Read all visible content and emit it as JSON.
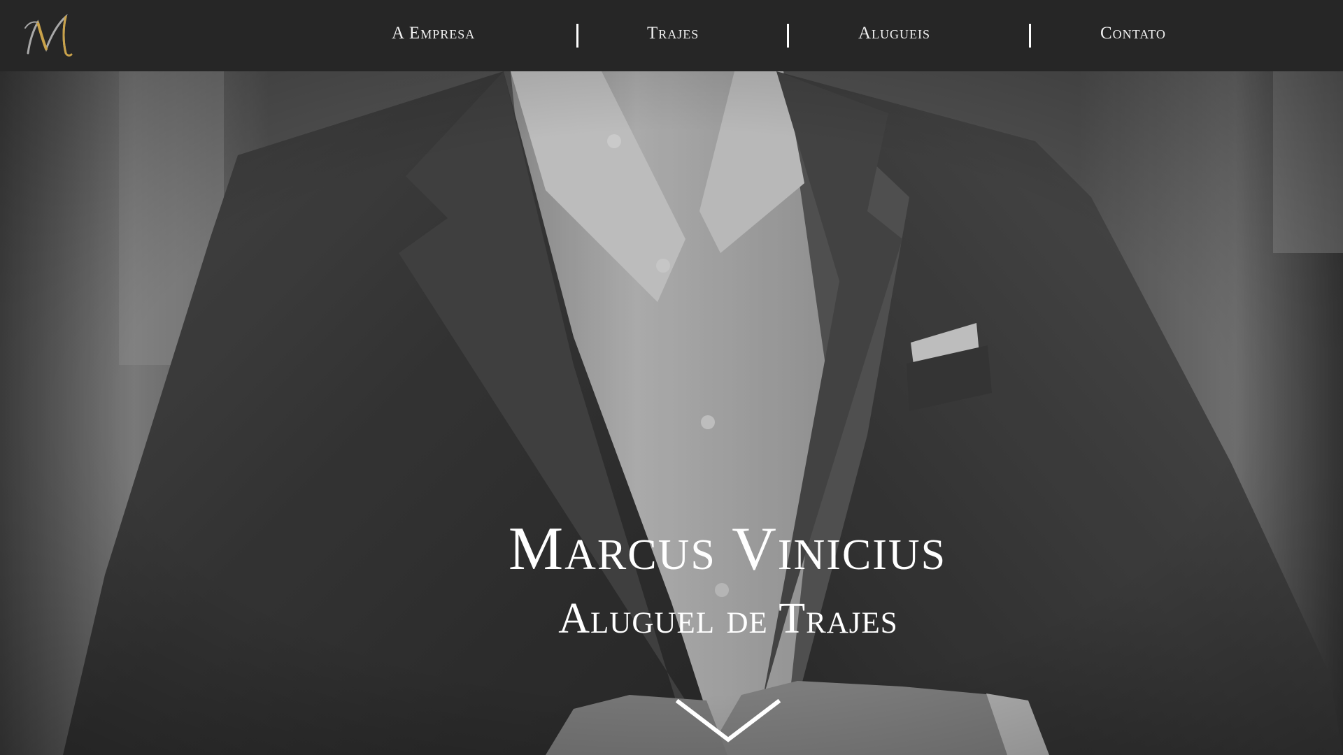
{
  "navbar": {
    "logo_letter": "M",
    "items": [
      {
        "label": "A Empresa"
      },
      {
        "label": "Trajes"
      },
      {
        "label": "Alugueis"
      },
      {
        "label": "Contato"
      }
    ]
  },
  "hero": {
    "title": "Marcus Vinicius",
    "subtitle": "Aluguel de Trajes",
    "scroll_icon": "chevron-down-icon",
    "photo": "grayscale man in dark suit jacket and white shirt buttoning jacket"
  },
  "colors": {
    "navbar_bg": "#262626",
    "nav_text": "#f1f1f1",
    "logo_gold": "#c9a24a",
    "logo_gray": "#a8a8a8",
    "hero_text": "#ffffff"
  }
}
